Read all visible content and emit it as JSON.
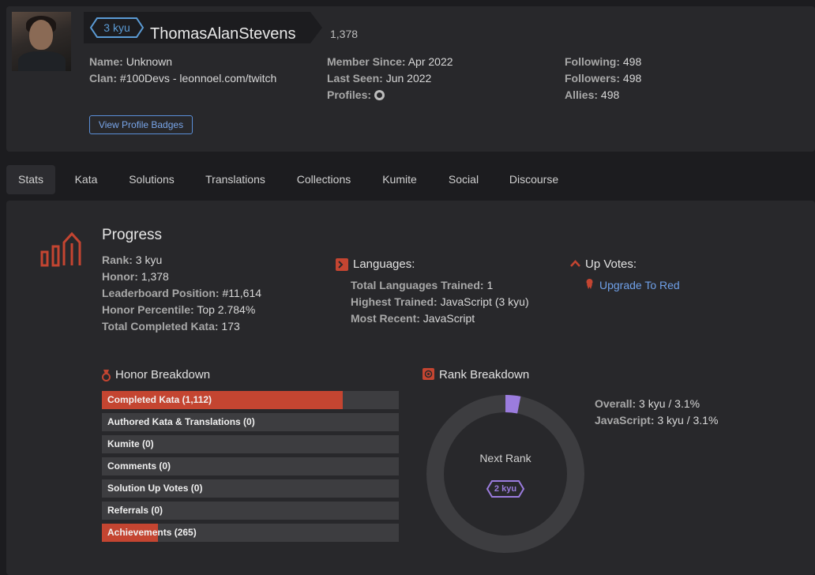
{
  "profile": {
    "rank_badge": "3 kyu",
    "username": "ThomasAlanStevens",
    "honor": "1,378",
    "name_label": "Name:",
    "name_value": "Unknown",
    "clan_label": "Clan:",
    "clan_value": "#100Devs - leonnoel.com/twitch",
    "member_since_label": "Member Since:",
    "member_since_value": "Apr 2022",
    "last_seen_label": "Last Seen:",
    "last_seen_value": "Jun 2022",
    "profiles_label": "Profiles:",
    "following_label": "Following:",
    "following_value": "498",
    "followers_label": "Followers:",
    "followers_value": "498",
    "allies_label": "Allies:",
    "allies_value": "498",
    "badges_button": "View Profile Badges"
  },
  "tabs": [
    "Stats",
    "Kata",
    "Solutions",
    "Translations",
    "Collections",
    "Kumite",
    "Social",
    "Discourse"
  ],
  "progress": {
    "title": "Progress",
    "rows": [
      {
        "label": "Rank:",
        "value": "3 kyu"
      },
      {
        "label": "Honor:",
        "value": "1,378"
      },
      {
        "label": "Leaderboard Position:",
        "value": "#11,614"
      },
      {
        "label": "Honor Percentile:",
        "value": "Top 2.784%"
      },
      {
        "label": "Total Completed Kata:",
        "value": "173"
      }
    ]
  },
  "languages": {
    "title": "Languages:",
    "rows": [
      {
        "label": "Total Languages Trained:",
        "value": "1"
      },
      {
        "label": "Highest Trained:",
        "value": "JavaScript (3 kyu)"
      },
      {
        "label": "Most Recent:",
        "value": "JavaScript"
      }
    ]
  },
  "upvotes": {
    "title": "Up Votes:",
    "link": "Upgrade To Red"
  },
  "honor_breakdown": {
    "title": "Honor Breakdown",
    "items": [
      {
        "label": "Completed Kata (1,112)",
        "fill": 0.81
      },
      {
        "label": "Authored Kata & Translations (0)",
        "fill": 0
      },
      {
        "label": "Kumite (0)",
        "fill": 0
      },
      {
        "label": "Comments (0)",
        "fill": 0
      },
      {
        "label": "Solution Up Votes (0)",
        "fill": 0
      },
      {
        "label": "Referrals (0)",
        "fill": 0
      },
      {
        "label": "Achievements (265)",
        "fill": 0.19
      }
    ]
  },
  "rank_breakdown": {
    "title": "Rank Breakdown",
    "progress_fraction": 0.031,
    "next_rank_label": "Next Rank",
    "next_rank_badge": "2 kyu",
    "overall_label": "Overall:",
    "overall_value": "3 kyu / 3.1%",
    "javascript_label": "JavaScript:",
    "javascript_value": "3 kyu / 3.1%"
  },
  "colors": {
    "accent_red": "#c44531",
    "link_blue": "#6fa0e8",
    "rank_blue": "#5b9bd5",
    "rank_purple": "#9b7cde"
  }
}
